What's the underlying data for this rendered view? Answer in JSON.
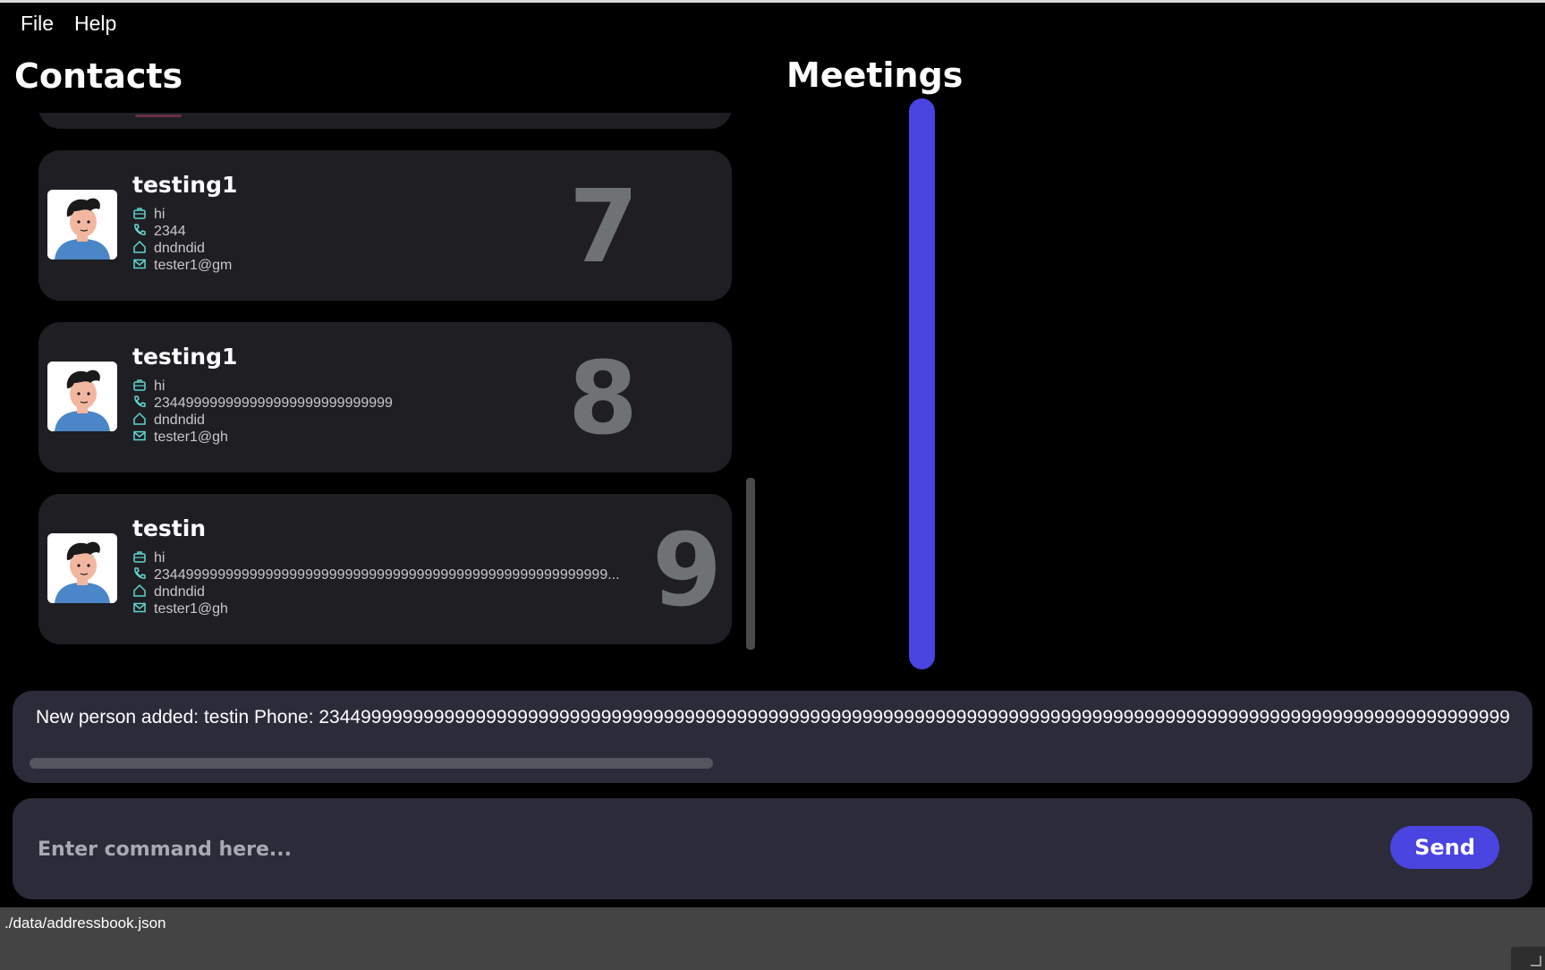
{
  "menu": {
    "file": "File",
    "help": "Help"
  },
  "contacts": {
    "title": "Contacts",
    "cards": [
      {
        "name": "testing1",
        "company": "hi",
        "phone": "2344",
        "address": "dndndid",
        "email": "tester1@gm",
        "index": "7"
      },
      {
        "name": "testing1",
        "company": "hi",
        "phone": "234499999999999999999999999999",
        "address": "dndndid",
        "email": "tester1@gh",
        "index": "8"
      },
      {
        "name": "testin",
        "company": "hi",
        "phone": "234499999999999999999999999999999999999999999999999999999...",
        "address": "dndndid",
        "email": "tester1@gh",
        "index": "9"
      }
    ]
  },
  "meetings": {
    "title": "Meetings"
  },
  "result": {
    "text": "New person added: testin Phone: 234499999999999999999999999999999999999999999999999999999999999999999999999999999999999999999999999999999999999999"
  },
  "command": {
    "placeholder": "Enter command here...",
    "value": "",
    "send_label": "Send"
  },
  "status": {
    "path": "./data/addressbook.json"
  },
  "colors": {
    "accent": "#4a44e0",
    "card_bg": "#1e1e23",
    "panel_bg": "#2b2b3a",
    "icon": "#5fd6d0",
    "index_number": "#6e7274"
  },
  "icons": {
    "company": "briefcase-icon",
    "phone": "phone-icon",
    "address": "home-icon",
    "email": "mail-icon"
  }
}
